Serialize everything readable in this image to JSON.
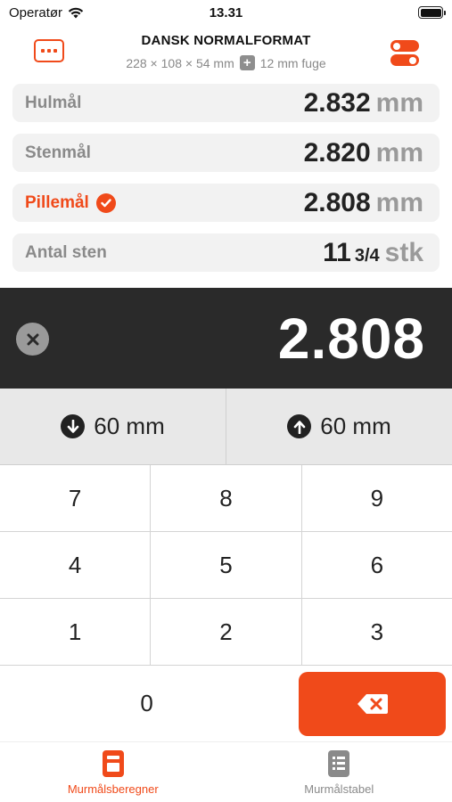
{
  "status_bar": {
    "carrier": "Operatør",
    "time": "13.31"
  },
  "header": {
    "title": "DANSK NORMALFORMAT",
    "subtitle_size": "228 × 108 × 54 mm",
    "subtitle_plus": "+",
    "subtitle_joint": "12 mm fuge"
  },
  "rows": [
    {
      "label": "Hulmål",
      "value": "2.832",
      "unit": "mm",
      "active": false
    },
    {
      "label": "Stenmål",
      "value": "2.820",
      "unit": "mm",
      "active": false
    },
    {
      "label": "Pillemål",
      "value": "2.808",
      "unit": "mm",
      "active": true
    },
    {
      "label": "Antal sten",
      "value": "11",
      "fraction": "3/4",
      "unit": "stk",
      "active": false
    }
  ],
  "display": {
    "value": "2.808"
  },
  "step": {
    "down_label": "60 mm",
    "up_label": "60 mm"
  },
  "keypad": {
    "keys": [
      "7",
      "8",
      "9",
      "4",
      "5",
      "6",
      "1",
      "2",
      "3"
    ],
    "zero": "0"
  },
  "tabs": [
    {
      "label": "Murmålsberegner",
      "active": true
    },
    {
      "label": "Murmålstabel",
      "active": false
    }
  ],
  "colors": {
    "accent": "#f04a1a",
    "display_bg": "#2a2a2a",
    "row_bg": "#f2f2f2"
  }
}
